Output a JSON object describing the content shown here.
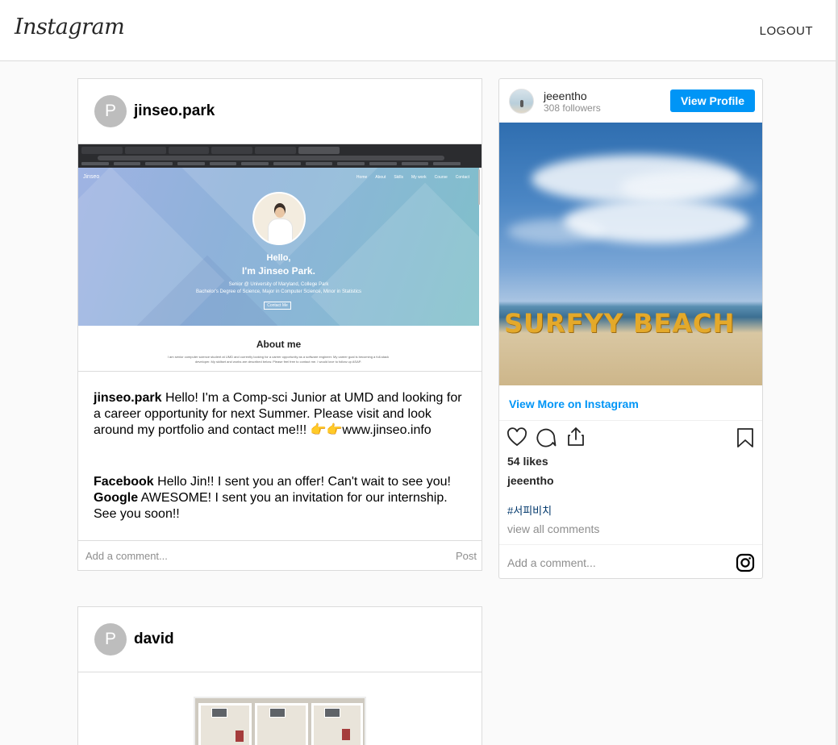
{
  "header": {
    "logo": "Instagram",
    "logout": "LOGOUT"
  },
  "posts": [
    {
      "avatar_letter": "P",
      "username": "jinseo.park",
      "screenshot": {
        "brand": "Jinseo",
        "nav": [
          "Home",
          "About",
          "Skills",
          "My work",
          "Course",
          "Contact"
        ],
        "hello_line1": "Hello,",
        "hello_line2": "I'm Jinseo Park.",
        "sub_line1": "Senior @ University of Maryland, College Park",
        "sub_line2": "Bachelor's Degree of Science, Major in Computer Science, Minor in Statistics",
        "button": "Contact Me",
        "about_title": "About me",
        "about_text": "I am senior computer science student at UMD and currently looking for a career opportunity as a software engineer. My career goal is becoming a full-stack developer. My skillset and works are described below. Please feel free to contact me. I would love to follow up ASAP."
      },
      "caption_user": "jinseo.park",
      "caption_text": "Hello! I'm a Comp-sci Junior at UMD and looking for a career opportunity for next Summer. Please visit and look around my portfolio and contact me!!! 👉👉www.jinseo.info",
      "comments": [
        {
          "user": "Facebook",
          "text": "Hello Jin!! I sent you an offer! Can't wait to see you!"
        },
        {
          "user": "Google",
          "text": "AWESOME! I sent you an invitation for our internship. See you soon!!"
        }
      ],
      "comment_placeholder": "Add a comment...",
      "post_label": "Post"
    },
    {
      "avatar_letter": "P",
      "username": "david"
    }
  ],
  "embed": {
    "username": "jeeentho",
    "followers": "308 followers",
    "view_profile": "View Profile",
    "image_sign": "SURFYY BEACH",
    "view_more": "View More on Instagram",
    "likes": "54 likes",
    "caption_user": "jeeentho",
    "hashtag": "#서피비치",
    "view_all": "view all comments",
    "comment_placeholder": "Add a comment...",
    "icons": [
      "heart-icon",
      "comment-icon",
      "share-icon",
      "bookmark-icon",
      "instagram-icon"
    ]
  }
}
